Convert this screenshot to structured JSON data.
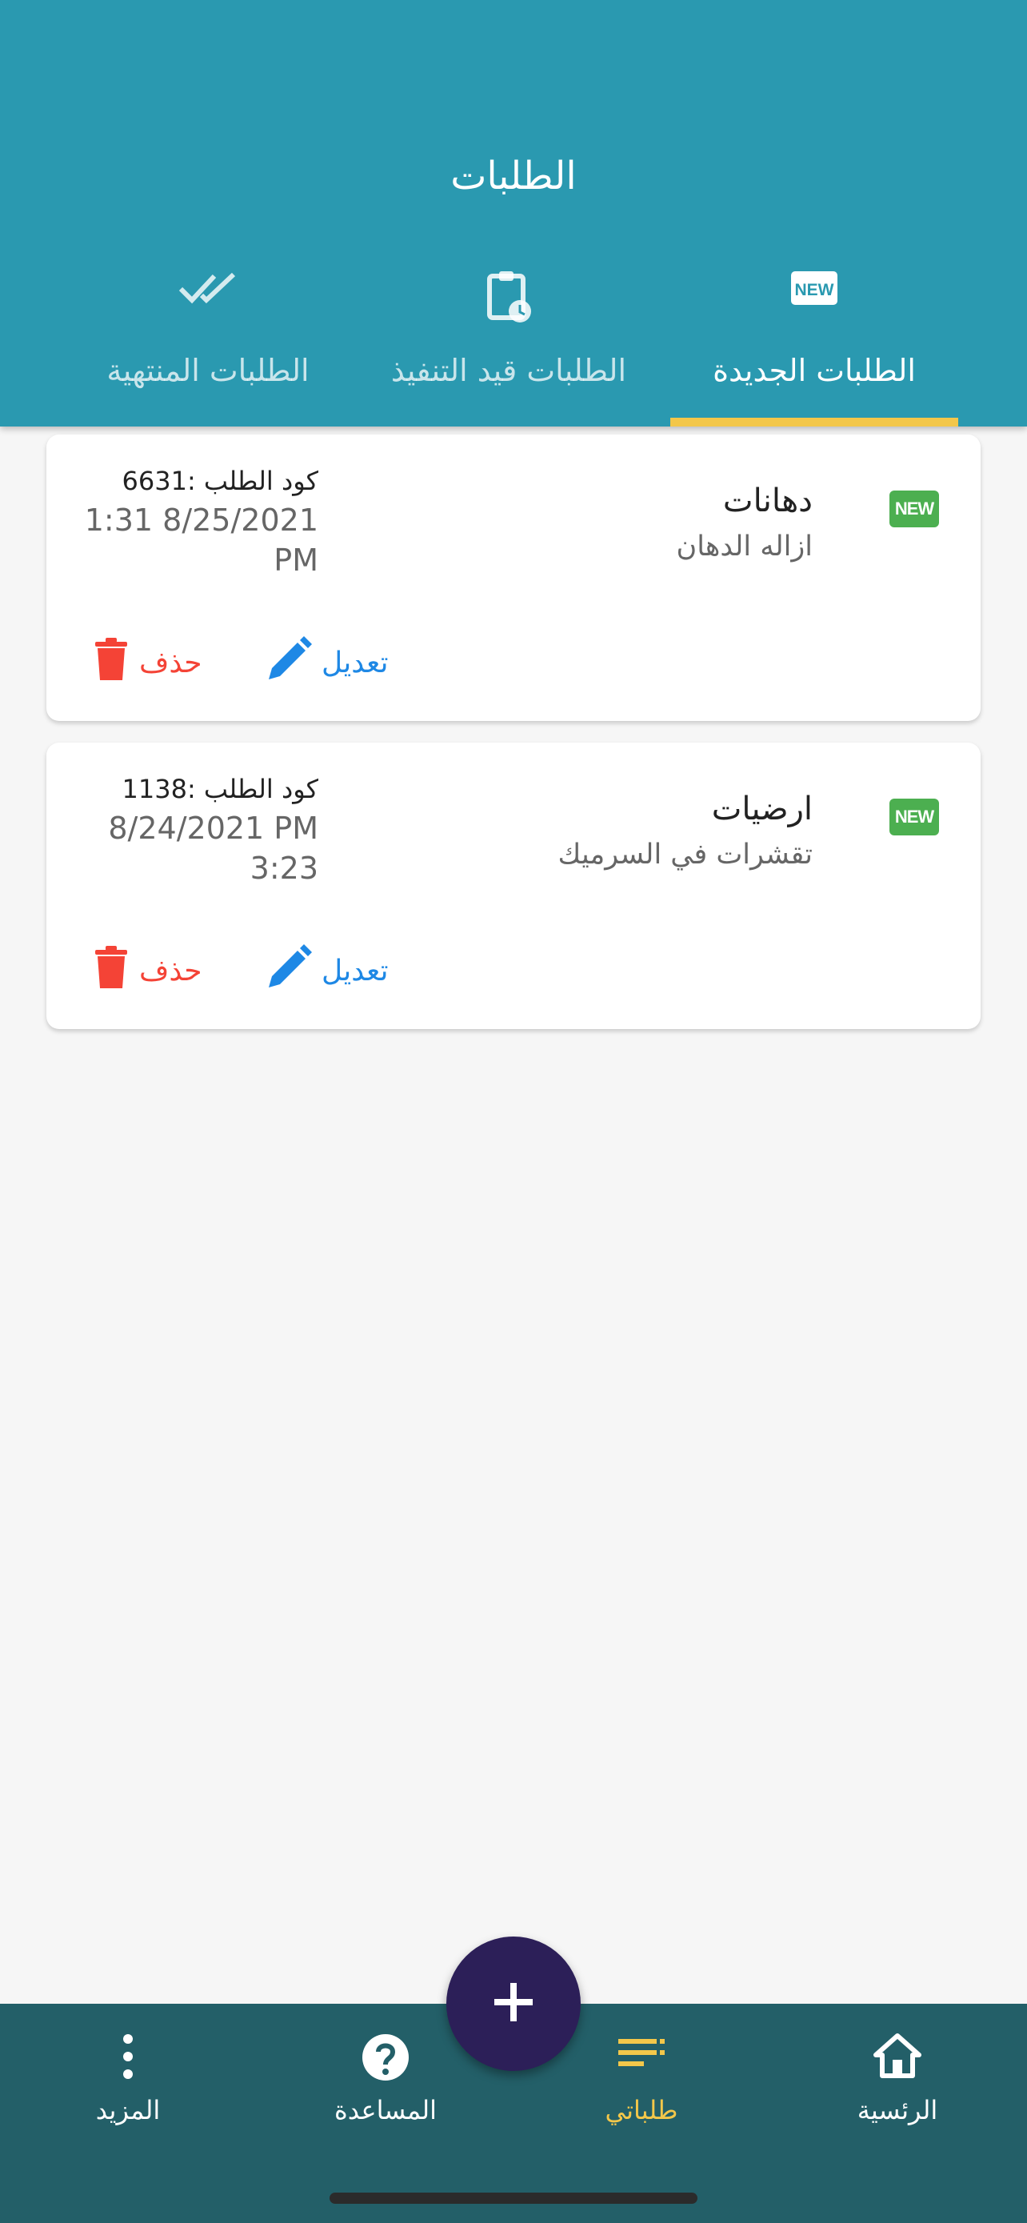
{
  "header": {
    "title": "الطلبات"
  },
  "tabs": [
    {
      "label": "الطلبات الجديدة",
      "icon": "new-badge-icon",
      "active": true
    },
    {
      "label": "الطلبات قيد التنفيذ",
      "icon": "clipboard-clock-icon",
      "active": false
    },
    {
      "label": "الطلبات المنتهية",
      "icon": "double-check-icon",
      "active": false
    }
  ],
  "badge_text": "NEW",
  "orders": [
    {
      "title": "دهانات",
      "subtitle": "ازاله الدهان",
      "code": "كود الطلب :6631",
      "date": "1:31 8/25/2021 PM",
      "edit_label": "تعديل",
      "delete_label": "حذف"
    },
    {
      "title": "ارضيات",
      "subtitle": "تقشرات في السرميك",
      "code": "كود الطلب :1138",
      "date": "8/24/2021 PM 3:23",
      "edit_label": "تعديل",
      "delete_label": "حذف"
    }
  ],
  "bottom_nav": [
    {
      "label": "الرئسية",
      "icon": "home-icon",
      "active": false
    },
    {
      "label": "طلباتي",
      "icon": "list-icon",
      "active": true
    },
    {
      "label": "المساعدة",
      "icon": "help-icon",
      "active": false
    },
    {
      "label": "المزيد",
      "icon": "more-vertical-icon",
      "active": false
    }
  ],
  "fab": {
    "icon": "plus-icon"
  },
  "colors": {
    "primary": "#2a99b0",
    "accent": "#f3c74a",
    "bottom_bar": "#235f68",
    "fab": "#2c1f58",
    "edit": "#1e88e5",
    "delete": "#f44336",
    "new_badge": "#4caf50"
  }
}
